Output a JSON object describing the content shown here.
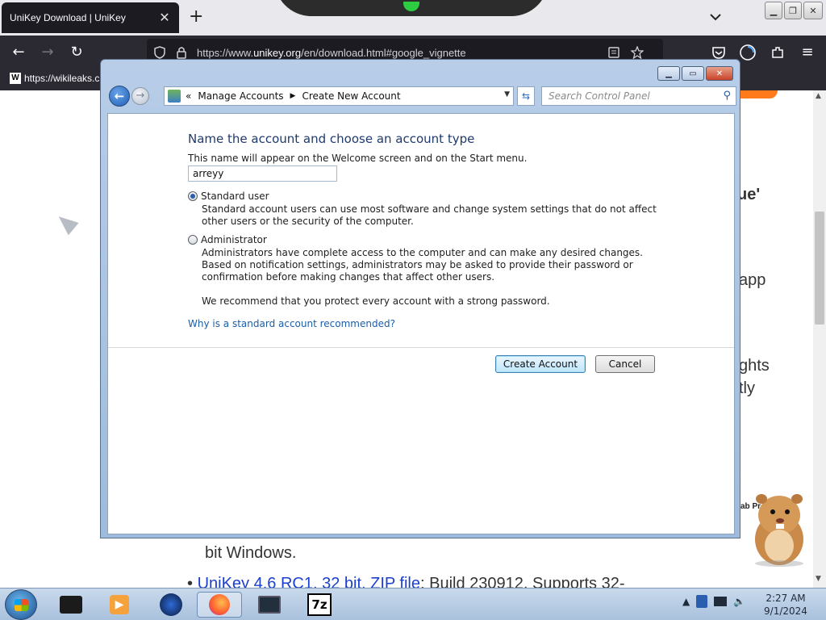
{
  "browser": {
    "tab_title": "UniKey Download | UniKey",
    "tab_close": "✕",
    "new_tab": "+",
    "url_prefix": "https://www.",
    "url_domain": "unikey.org",
    "url_path": "/en/download.html#google_vignette",
    "bookmark_label": "https://wikileaks.c",
    "bookmark_icon_letter": "W"
  },
  "webpage": {
    "frag_ue": "ue'",
    "frag_app": "app",
    "frag_ghts": "ghts",
    "frag_tly": "tly",
    "frag_abpr": "ab Pr",
    "frag_bitwindows": "bit Windows.",
    "frag_link": "UniKey 4.6 RC1, 32 bit, ZIP file",
    "frag_rest": ": Build 230912. Supports 32-"
  },
  "control_panel": {
    "breadcrumb_root": "«",
    "breadcrumb_1": "Manage Accounts",
    "breadcrumb_2": "Create New Account",
    "search_placeholder": "Search Control Panel",
    "heading": "Name the account and choose an account type",
    "name_hint": "This name will appear on the Welcome screen and on the Start menu.",
    "account_name_value": "arreyy",
    "standard_label": "Standard user",
    "standard_desc": "Standard account users can use most software and change system settings that do not affect other users or the security of the computer.",
    "admin_label": "Administrator",
    "admin_desc": "Administrators have complete access to the computer and can make any desired changes. Based on notification settings, administrators may be asked to provide their password or confirmation before making changes that affect other users.",
    "recommend_text": "We recommend that you protect every account with a strong password.",
    "why_link": "Why is a standard account recommended?",
    "create_button": "Create Account",
    "cancel_button": "Cancel",
    "selected_account_type": "Standard user"
  },
  "taskbar": {
    "time": "2:27 AM",
    "date": "9/1/2024",
    "sevenzip_label": "7z"
  },
  "colors": {
    "heading_blue": "#1f3a6e",
    "link_blue": "#1a5ea8",
    "browser_dark": "#2b2a33",
    "accent_orange": "#ff7a1a"
  }
}
